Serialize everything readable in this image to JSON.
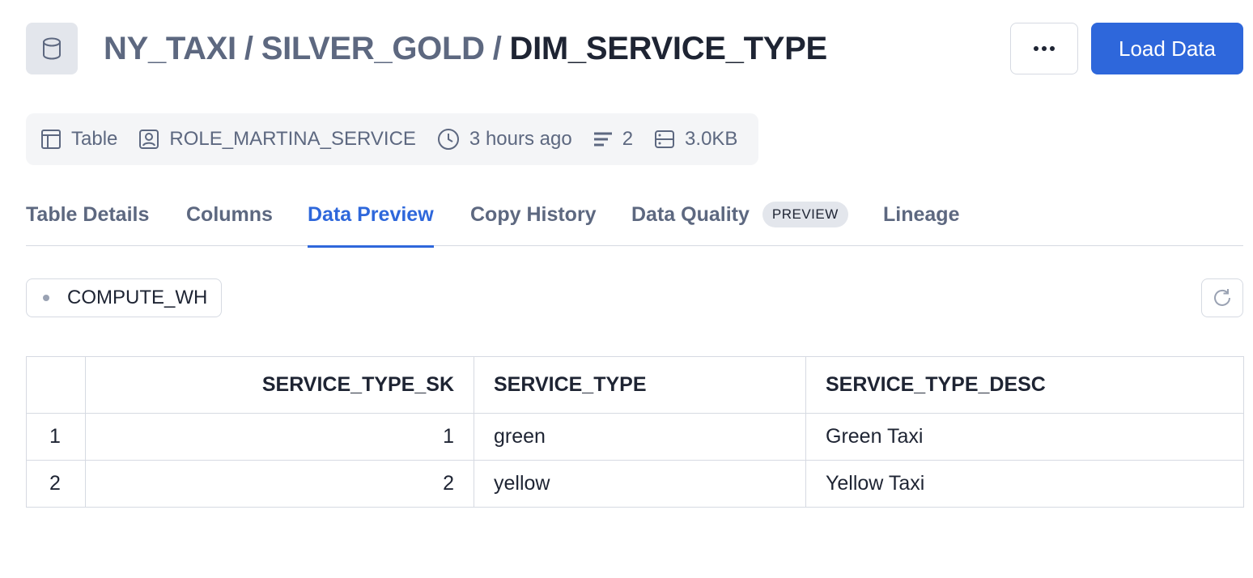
{
  "header": {
    "breadcrumb": [
      "NY_TAXI",
      "SILVER_GOLD"
    ],
    "separator": "/",
    "current": "DIM_SERVICE_TYPE",
    "icon": "database-icon",
    "more_icon": "ellipsis-icon",
    "load_label": "Load Data"
  },
  "meta": {
    "type": "Table",
    "owner": "ROLE_MARTINA_SERVICE",
    "updated": "3 hours ago",
    "columns_count": "2",
    "size": "3.0KB"
  },
  "tabs": [
    {
      "label": "Table Details"
    },
    {
      "label": "Columns"
    },
    {
      "label": "Data Preview",
      "active": true
    },
    {
      "label": "Copy History"
    },
    {
      "label": "Data Quality",
      "badge": "PREVIEW"
    },
    {
      "label": "Lineage"
    }
  ],
  "warehouse": "COMPUTE_WH",
  "table": {
    "headers": [
      "",
      "SERVICE_TYPE_SK",
      "SERVICE_TYPE",
      "SERVICE_TYPE_DESC"
    ],
    "rows": [
      [
        "1",
        "1",
        "green",
        "Green Taxi"
      ],
      [
        "2",
        "2",
        "yellow",
        "Yellow Taxi"
      ]
    ]
  },
  "colors": {
    "accent": "#2e67db",
    "muted_text": "#5d6880",
    "border": "#d6dae2"
  }
}
